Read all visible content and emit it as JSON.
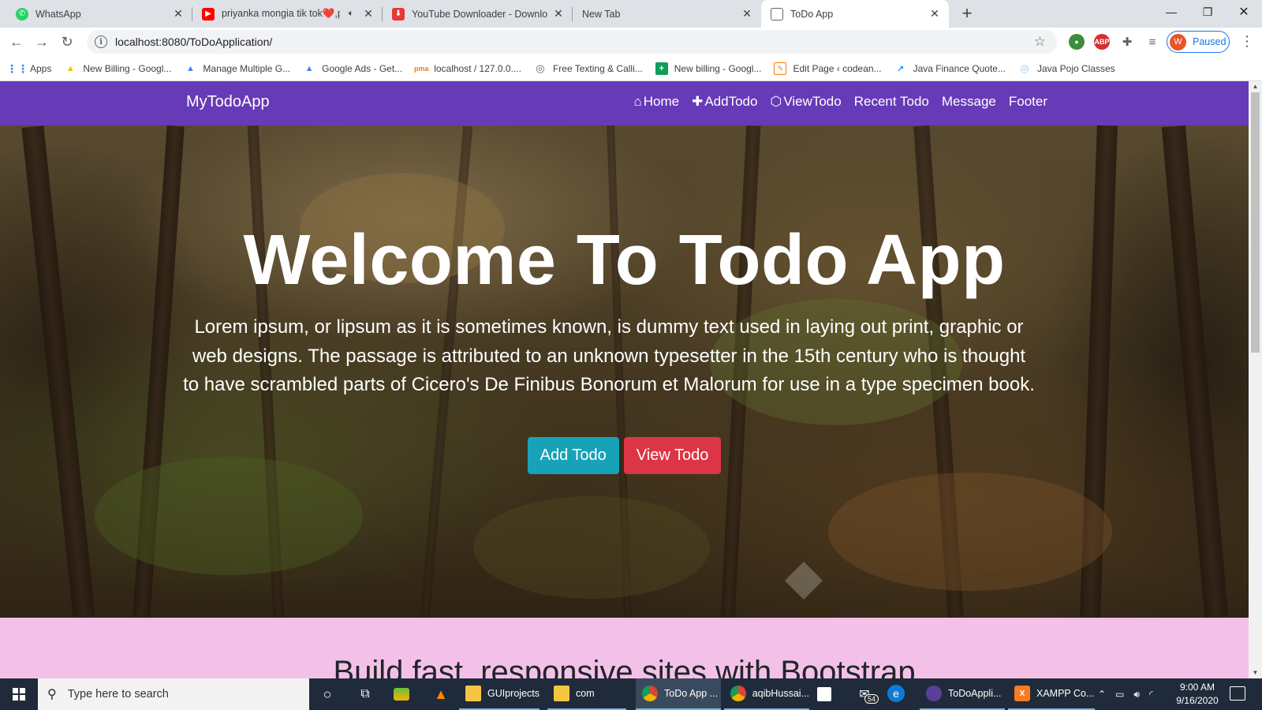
{
  "browser": {
    "tabs": [
      {
        "title": "WhatsApp",
        "icon": "whatsapp-icon",
        "color": "#25d366",
        "active": false
      },
      {
        "title": "priyanka mongia tik tok❤️,p",
        "icon": "youtube-icon",
        "color": "#ff0000",
        "active": false
      },
      {
        "title": "YouTube Downloader - Downloa",
        "icon": "download-icon",
        "color": "#e53935",
        "active": false
      },
      {
        "title": "New Tab",
        "icon": "",
        "color": "",
        "active": false
      },
      {
        "title": "ToDo App",
        "icon": "page-icon",
        "color": "#5f6368",
        "active": true
      }
    ],
    "url": "localhost:8080/ToDoApplication/",
    "profile_initial": "W",
    "profile_status": "Paused",
    "bookmarks": [
      {
        "label": "Apps",
        "icon": "apps-grid-icon"
      },
      {
        "label": "New Billing - Googl...",
        "icon": "google-ads-icon"
      },
      {
        "label": "Manage Multiple G...",
        "icon": "google-ads-icon"
      },
      {
        "label": "Google Ads - Get...",
        "icon": "google-ads-icon"
      },
      {
        "label": "localhost / 127.0.0....",
        "icon": "phpmyadmin-icon"
      },
      {
        "label": "Free Texting & Calli...",
        "icon": "globe-icon"
      },
      {
        "label": "New billing - Googl...",
        "icon": "sheets-icon"
      },
      {
        "label": "Edit Page ‹ codean...",
        "icon": "codeanywhere-icon"
      },
      {
        "label": "Java Finance Quote...",
        "icon": "chart-line-icon"
      },
      {
        "label": "Java Pojo Classes",
        "icon": "globe-icon"
      }
    ]
  },
  "site": {
    "brand": "MyTodoApp",
    "nav": [
      {
        "label": "Home",
        "icon": "home-icon"
      },
      {
        "label": "AddTodo",
        "icon": "plus-icon"
      },
      {
        "label": "ViewTodo",
        "icon": "eye-icon"
      },
      {
        "label": "Recent Todo",
        "icon": ""
      },
      {
        "label": "Message",
        "icon": ""
      },
      {
        "label": "Footer",
        "icon": ""
      }
    ],
    "hero": {
      "title": "Welcome To Todo App",
      "text": "Lorem ipsum, or lipsum as it is sometimes known, is dummy text used in laying out print, graphic or web designs. The passage is attributed to an unknown typesetter in the 15th century who is thought to have scrambled parts of Cicero's De Finibus Bonorum et Malorum for use in a type specimen book.",
      "add_button": "Add Todo",
      "view_button": "View Todo"
    },
    "section2_heading": "Build fast, responsive sites with Bootstrap",
    "colors": {
      "navbar": "#673ab7",
      "add": "#17a2b8",
      "view": "#dc3545",
      "section2": "#f3c1e8"
    }
  },
  "taskbar": {
    "search_placeholder": "Type here to search",
    "apps": [
      {
        "label": "GUIprojects",
        "icon": "folder-icon"
      },
      {
        "label": "com",
        "icon": "folder-icon"
      },
      {
        "label": "ToDo App ...",
        "icon": "chrome-icon"
      },
      {
        "label": "aqibHussai...",
        "icon": "chrome-icon"
      },
      {
        "label": "ToDoAppli...",
        "icon": "eclipse-icon"
      },
      {
        "label": "XAMPP Co...",
        "icon": "xampp-icon"
      }
    ],
    "mail_badge": "54",
    "time": "9:00 AM",
    "date": "9/16/2020"
  }
}
